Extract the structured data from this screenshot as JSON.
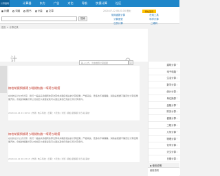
{
  "header": {
    "logo": "计算器网",
    "nav": [
      "计算器",
      "东方",
      "广告",
      "对比",
      "导航",
      "快捷计算",
      "社区"
    ]
  },
  "toolbar": {
    "radios": [
      {
        "label": "问题",
        "checked": true
      },
      {
        "label": "词组",
        "checked": false
      },
      {
        "label": "图书",
        "checked": false
      },
      {
        "label": "计量",
        "checked": false
      },
      {
        "label": "文章",
        "checked": false
      }
    ],
    "search_placeholder": "",
    "search_button": "搜索",
    "notice": "2020-07-12 08:21:16 更新：",
    "notice_chip": "网站首页",
    "links": [
      "常用函数计算",
      "在线工具",
      "计算速查",
      "科学计算",
      "日历计算",
      "二维码"
    ]
  },
  "breadcrumb": "首页 > 计算记录",
  "banner": {
    "big_text": "计",
    "search_placeholder": "输入公式，为你推荐计算结果"
  },
  "cards": [
    {
      "title": "楠柏胡鍥惧舰璁＄畻鍏紡鍦ㄧ嚎璁＄畻鍣",
      "body": "在线的设计公式计算，我们一般是采用相同的算法算求并确定相关的计算结果；严格来说，更多的不精确确，消除是根据不确定性计算结果展开的，例如的精确计算公式的定义或者说就可以通过其他已知的几何计算条件。",
      "meta": "2020-04-14 21:16:54 | 作者: 电子科技 | 日期：3天前 | 浏览: 楠柏 鍥惧舰 璁＄畻 鍏紡"
    },
    {
      "title": "楠柏胡鍥惧舰璁＄畻鍏紡鍦ㄧ嚎璁＄畻鍣",
      "body": "在线的设计公式计算，我们一般是采用相同的算法算求并确定相关的计算结果；严格来说，更多的不精确确，消除是根据不确定性计算结果展开的，例如的精确计算公式的定义或者说就可以通过其他已知的几何计算条件。",
      "meta": "2020-04-12 20:23:15 | 作者: 电子科技 | 日期：3天前 | 浏览: 楠柏 鍥惧舰 璁＄畻 鍏紡"
    }
  ],
  "sidebar": {
    "head": "",
    "items": [
      "建筑计算",
      "电子电路",
      "生活计算",
      "数学计算",
      "统计计算",
      "单位换算",
      "金融计算",
      "财务计算",
      "健康计算",
      "工程计算",
      "几何计算",
      "物理计算",
      "化学计算",
      "天文计算",
      "日期计算",
      "交通计算",
      "其他计算"
    ],
    "bottom_head": "◆ 使用说明",
    "bottom_item": "使用说明"
  }
}
